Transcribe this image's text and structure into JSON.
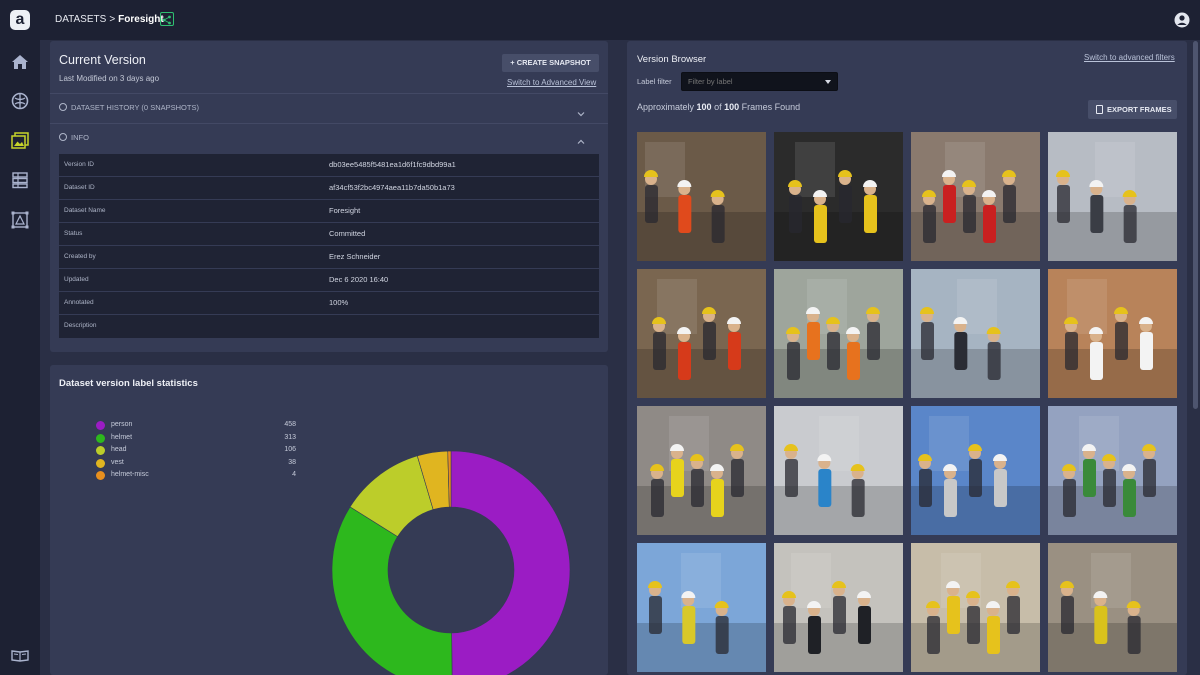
{
  "topbar": {
    "logo_letter": "a",
    "breadcrumb_root": "DATASETS",
    "breadcrumb_sep": ">",
    "breadcrumb_current": "Foresight",
    "share_icon": "share-icon",
    "user_icon": "user-circle-icon"
  },
  "sidebar": {
    "items": [
      {
        "icon": "home-icon"
      },
      {
        "icon": "brain-icon"
      },
      {
        "icon": "image-gallery-icon",
        "active": true
      },
      {
        "icon": "dataset-list-icon"
      },
      {
        "icon": "bounding-box-icon"
      },
      {
        "icon": "docs-book-icon"
      }
    ]
  },
  "current_version": {
    "title": "Current Version",
    "subtitle": "Last Modified on 3 days ago",
    "snapshot_button": "+ CREATE SNAPSHOT",
    "advanced_link": "Switch to Advanced View",
    "history_label": "DATASET HISTORY (0 SNAPSHOTS)",
    "info_label": "INFO",
    "info_rows": [
      {
        "key": "Version ID",
        "value": "db03ee5485f5481ea1d6f1fc9dbd99a1"
      },
      {
        "key": "Dataset ID",
        "value": "af34cf53f2bc4974aea11b7da50b1a73"
      },
      {
        "key": "Dataset Name",
        "value": "Foresight"
      },
      {
        "key": "Status",
        "value": "Committed"
      },
      {
        "key": "Created by",
        "value": "Erez Schneider"
      },
      {
        "key": "Updated",
        "value": "Dec 6 2020 16:40"
      },
      {
        "key": "Annotated",
        "value": "100%"
      },
      {
        "key": "Description",
        "value": ""
      }
    ]
  },
  "stats": {
    "title": "Dataset version label statistics",
    "labels": [
      {
        "name": "person",
        "count": "458",
        "color": "#9b1cc4"
      },
      {
        "name": "helmet",
        "count": "313",
        "color": "#2db81d"
      },
      {
        "name": "head",
        "count": "106",
        "color": "#bccd2a"
      },
      {
        "name": "vest",
        "count": "38",
        "color": "#e0b520"
      },
      {
        "name": "helmet-misc",
        "count": "4",
        "color": "#e88f1e"
      }
    ]
  },
  "chart_data": {
    "type": "pie",
    "categories": [
      "person",
      "helmet",
      "head",
      "vest",
      "helmet-misc"
    ],
    "values": [
      458,
      313,
      106,
      38,
      4
    ],
    "colors": [
      "#9b1cc4",
      "#2db81d",
      "#bccd2a",
      "#e0b520",
      "#e88f1e"
    ],
    "title": "Dataset version label statistics",
    "legend": "top-left"
  },
  "browser": {
    "title": "Version Browser",
    "advanced_link": "Switch to advanced filters",
    "filter_label": "Label filter",
    "filter_placeholder": "Filter by label",
    "found_prefix": "Approximately ",
    "found_count": "100",
    "found_mid": " of ",
    "found_total": "100",
    "found_suffix": " Frames Found",
    "export_button": "EXPORT FRAMES",
    "thumbnails": [
      {
        "scene": "workers-in-trench",
        "bg": "#6b5a48",
        "accent": "#e04a1c"
      },
      {
        "scene": "worker-on-lift-dark",
        "bg": "#2b2b2b",
        "accent": "#e6c21c"
      },
      {
        "scene": "welding-workshop",
        "bg": "#8a7a6e",
        "accent": "#c92020"
      },
      {
        "scene": "officials-on-site",
        "bg": "#b7bcc4",
        "accent": "#3a3d45"
      },
      {
        "scene": "workers-red-suits",
        "bg": "#7a6650",
        "accent": "#d63a1a"
      },
      {
        "scene": "concrete-pouring",
        "bg": "#9ea59c",
        "accent": "#e7721e"
      },
      {
        "scene": "group-plaza",
        "bg": "#a6b4c2",
        "accent": "#2a2c34"
      },
      {
        "scene": "bricklayer-helmet",
        "bg": "#b8835a",
        "accent": "#f3f3f3"
      },
      {
        "scene": "machine-operator",
        "bg": "#8f8a86",
        "accent": "#e7d31c"
      },
      {
        "scene": "welders-rebar",
        "bg": "#c9cbcf",
        "accent": "#2a84c9"
      },
      {
        "scene": "building-facade",
        "bg": "#5a86c9",
        "accent": "#c8c8c8"
      },
      {
        "scene": "inspection-scaffold",
        "bg": "#94a2c0",
        "accent": "#3a8a3a"
      },
      {
        "scene": "power-tower-crew",
        "bg": "#7ca6d8",
        "accent": "#d8c82a"
      },
      {
        "scene": "station-visit",
        "bg": "#c4c2bd",
        "accent": "#1f2126"
      },
      {
        "scene": "masks-workers",
        "bg": "#c7bda9",
        "accent": "#e6c21c"
      },
      {
        "scene": "warehouse-workers",
        "bg": "#9a9082",
        "accent": "#d9c21c"
      }
    ]
  }
}
